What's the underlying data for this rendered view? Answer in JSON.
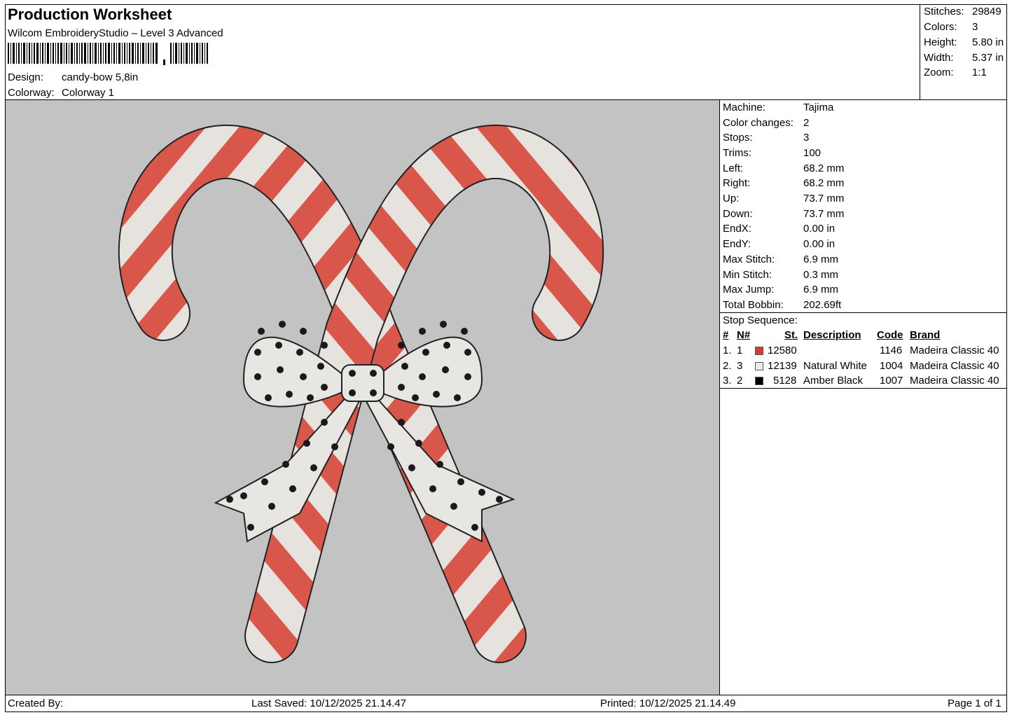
{
  "header": {
    "title": "Production Worksheet",
    "software": "Wilcom EmbroideryStudio – Level 3 Advanced",
    "design_label": "Design:",
    "design_value": "candy-bow 5,8in",
    "colorway_label": "Colorway:",
    "colorway_value": "Colorway 1"
  },
  "stats": [
    {
      "label": "Stitches:",
      "value": "29849"
    },
    {
      "label": "Colors:",
      "value": "3"
    },
    {
      "label": "Height:",
      "value": "5.80 in"
    },
    {
      "label": "Width:",
      "value": "5.37 in"
    },
    {
      "label": "Zoom:",
      "value": "1:1"
    }
  ],
  "machine_info": [
    {
      "label": "Machine:",
      "value": "Tajima"
    },
    {
      "label": "Color changes:",
      "value": "2"
    },
    {
      "label": "Stops:",
      "value": "3"
    },
    {
      "label": "Trims:",
      "value": "100"
    },
    {
      "label": "Left:",
      "value": "68.2 mm"
    },
    {
      "label": "Right:",
      "value": "68.2 mm"
    },
    {
      "label": "Up:",
      "value": "73.7 mm"
    },
    {
      "label": "Down:",
      "value": "73.7 mm"
    },
    {
      "label": "EndX:",
      "value": "0.00 in"
    },
    {
      "label": "EndY:",
      "value": "0.00 in"
    },
    {
      "label": "Max Stitch:",
      "value": "6.9 mm"
    },
    {
      "label": "Min Stitch:",
      "value": "0.3 mm"
    },
    {
      "label": "Max Jump:",
      "value": "6.9 mm"
    },
    {
      "label": "Total Bobbin:",
      "value": "202.69ft"
    }
  ],
  "stop_sequence": {
    "title": "Stop Sequence:",
    "columns": [
      "#",
      "N#",
      "St.",
      "Description",
      "Code",
      "Brand"
    ],
    "rows": [
      {
        "idx": "1.",
        "n": "1",
        "color": "#d93a30",
        "st": "12580",
        "desc": "",
        "code": "1146",
        "brand": "Madeira Classic 40"
      },
      {
        "idx": "2.",
        "n": "3",
        "color": "#ececec",
        "st": "12139",
        "desc": "Natural White",
        "code": "1004",
        "brand": "Madeira Classic 40"
      },
      {
        "idx": "3.",
        "n": "2",
        "color": "#000000",
        "st": "5128",
        "desc": "Amber Black",
        "code": "1007",
        "brand": "Madeira Classic 40"
      }
    ]
  },
  "footer": {
    "created_by": "Created By:",
    "last_saved": "Last Saved: 10/12/2025 21.14.47",
    "printed": "Printed: 10/12/2025 21.14.49",
    "page": "Page 1 of 1"
  }
}
